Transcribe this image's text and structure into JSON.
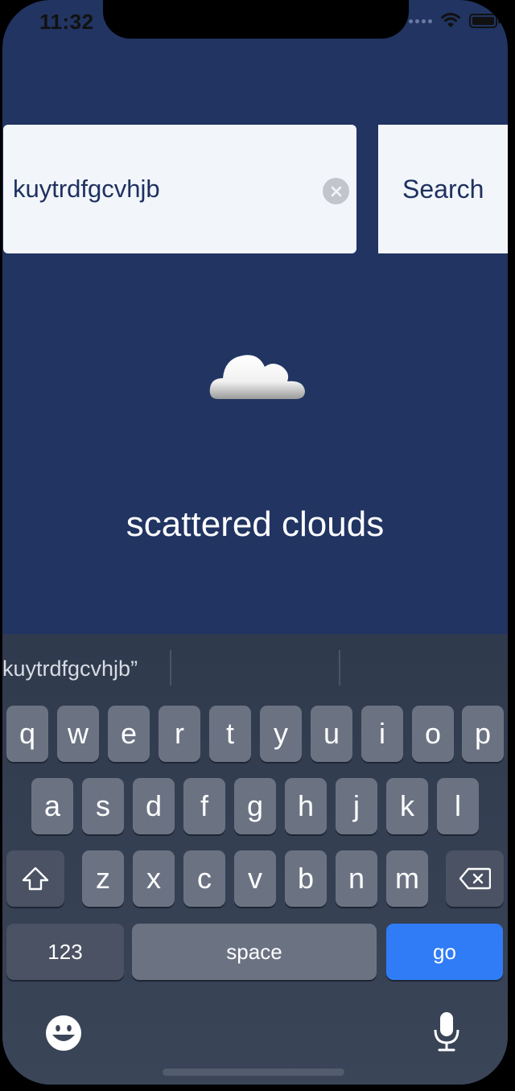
{
  "status": {
    "time": "11:32"
  },
  "search": {
    "value": "kuytrdfgcvhjb",
    "button_label": "Search"
  },
  "weather": {
    "description": "scattered clouds",
    "icon": "cloud-icon"
  },
  "keyboard": {
    "suggestion": "kuytrdfgcvhjb”",
    "row1": [
      "q",
      "w",
      "e",
      "r",
      "t",
      "y",
      "u",
      "i",
      "o",
      "p"
    ],
    "row2": [
      "a",
      "s",
      "d",
      "f",
      "g",
      "h",
      "j",
      "k",
      "l"
    ],
    "row3": [
      "z",
      "x",
      "c",
      "v",
      "b",
      "n",
      "m"
    ],
    "numbers_label": "123",
    "space_label": "space",
    "go_label": "go"
  },
  "colors": {
    "background": "#213462",
    "go_key": "#2f7cf6"
  }
}
